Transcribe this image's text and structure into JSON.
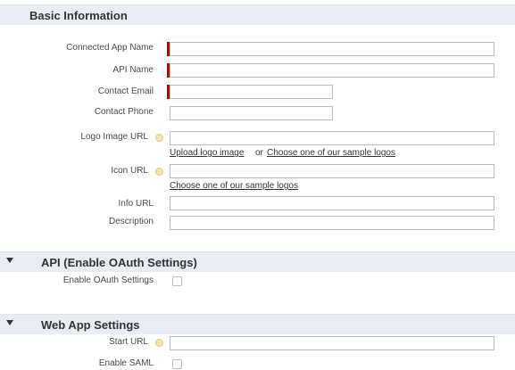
{
  "basic_information": {
    "title": "Basic Information",
    "fields": {
      "connected_app_name": {
        "label": "Connected App Name",
        "value": ""
      },
      "api_name": {
        "label": "API Name",
        "value": ""
      },
      "contact_email": {
        "label": "Contact Email",
        "value": ""
      },
      "contact_phone": {
        "label": "Contact Phone",
        "value": ""
      },
      "logo_image_url": {
        "label": "Logo Image URL",
        "value": ""
      },
      "icon_url": {
        "label": "Icon URL",
        "value": ""
      },
      "info_url": {
        "label": "Info URL",
        "value": ""
      },
      "description": {
        "label": "Description",
        "value": ""
      }
    },
    "upload_logo_link": "Upload logo image",
    "or_text": "or",
    "sample_logos_link": "Choose one of our sample logos",
    "icon_sample_logos_link": "Choose one of our sample logos"
  },
  "api_section": {
    "title": "API (Enable OAuth Settings)",
    "enable_oauth_label": "Enable OAuth Settings",
    "enable_oauth_checked": false
  },
  "web_app_section": {
    "title": "Web App Settings",
    "start_url_label": "Start URL",
    "start_url_value": "",
    "enable_saml_label": "Enable SAML",
    "enable_saml_checked": false
  },
  "colors": {
    "section_header_bg": "#e8edf3",
    "required_marker": "#c00000",
    "help_icon": "#f4e4b8"
  },
  "icons": [
    "help-icon",
    "collapse-caret-icon",
    "required-marker"
  ]
}
